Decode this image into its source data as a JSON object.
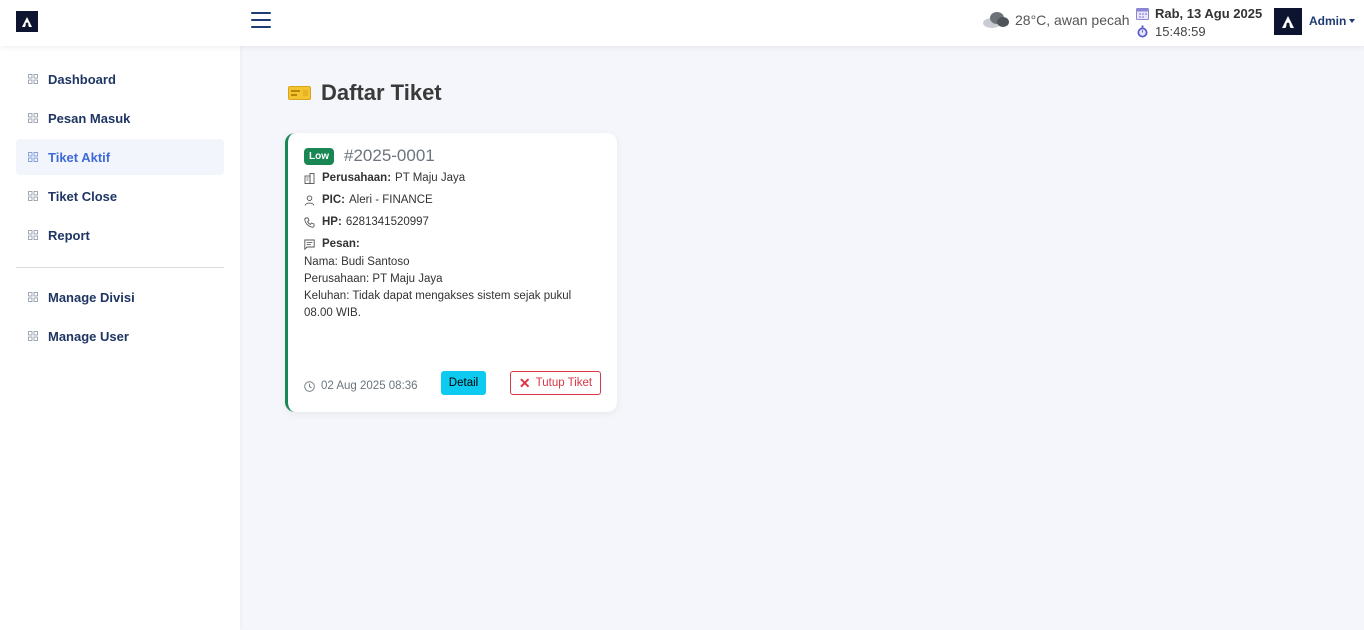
{
  "header": {
    "weather": "28°C, awan pecah",
    "date": "Rab, 13 Agu 2025",
    "time": "15:48:59",
    "user": "Admin"
  },
  "sidebar": {
    "items": [
      {
        "label": "Dashboard",
        "icon": "grid-icon"
      },
      {
        "label": "Pesan Masuk",
        "icon": "grid-icon"
      },
      {
        "label": "Tiket Aktif",
        "icon": "grid-icon",
        "active": true
      },
      {
        "label": "Tiket Close",
        "icon": "grid-icon"
      },
      {
        "label": "Report",
        "icon": "grid-icon"
      },
      {
        "label": "Manage Divisi",
        "icon": "grid-icon"
      },
      {
        "label": "Manage User",
        "icon": "grid-icon"
      }
    ]
  },
  "main": {
    "title": "Daftar Tiket",
    "ticket": {
      "priority": "Low",
      "number": "#2025-0001",
      "company_label": "Perusahaan:",
      "company": "PT Maju Jaya",
      "pic_label": "PIC:",
      "pic": "Aleri - FINANCE",
      "hp_label": "HP:",
      "hp": "6281341520997",
      "message_label": "Pesan:",
      "message_lines": [
        "Nama: Budi Santoso",
        "Perusahaan: PT Maju Jaya",
        "Keluhan: Tidak dapat mengakses sistem sejak pukul 08.00 WIB."
      ],
      "timestamp": "02 Aug 2025 08:36",
      "detail_label": "Detail",
      "close_label": "Tutup Tiket"
    }
  },
  "colors": {
    "accent": "#3f6ad8",
    "nav_text": "#1f3563",
    "success": "#198754",
    "info": "#0dcaf0",
    "danger": "#dc3545",
    "dark": "#0d1430"
  }
}
